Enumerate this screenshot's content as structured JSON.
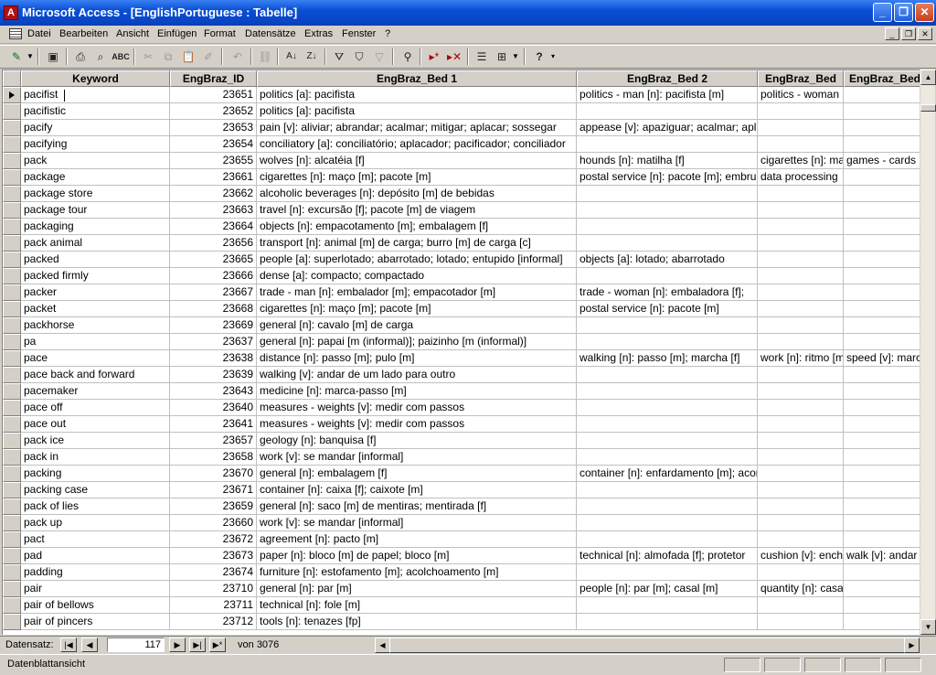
{
  "window": {
    "title": "Microsoft Access - [EnglishPortuguese : Tabelle]",
    "min_label": "_",
    "max_label": "❐",
    "close_label": "✕"
  },
  "menu": [
    "Datei",
    "Bearbeiten",
    "Ansicht",
    "Einfügen",
    "Format",
    "Datensätze",
    "Extras",
    "Fenster",
    "?"
  ],
  "toolbar": {
    "icons": [
      "design-view-icon",
      "save-icon",
      "print-icon",
      "print-preview-icon",
      "spelling-icon",
      "cut-icon",
      "copy-icon",
      "paste-icon",
      "format-painter-icon",
      "undo-icon",
      "insert-hyperlink-icon",
      "sort-ascending-icon",
      "sort-descending-icon",
      "filter-by-selection-icon",
      "filter-by-form-icon",
      "apply-filter-icon",
      "find-icon",
      "new-record-icon",
      "delete-record-icon",
      "properties-icon",
      "new-object-icon",
      "help-icon"
    ]
  },
  "table": {
    "columns": [
      "Keyword",
      "EngBraz_ID",
      "EngBraz_Bed 1",
      "EngBraz_Bed 2",
      "EngBraz_Bed",
      "EngBraz_Bed"
    ],
    "rows": [
      [
        "pacifist",
        "23651",
        "politics [a]: pacifista",
        "politics - man [n]: pacifista [m]",
        "politics - woman",
        ""
      ],
      [
        "pacifistic",
        "23652",
        "politics [a]: pacifista",
        "",
        "",
        ""
      ],
      [
        "pacify",
        "23653",
        "pain [v]: aliviar; abrandar; acalmar; mitigar; aplacar; sossegar",
        "appease [v]: apaziguar; acalmar; aplacar",
        "",
        ""
      ],
      [
        "pacifying",
        "23654",
        "conciliatory [a]: conciliatório; aplacador; pacificador; conciliador",
        "",
        "",
        ""
      ],
      [
        "pack",
        "23655",
        "wolves [n]: alcatéia [f]",
        "hounds [n]: matilha [f]",
        "cigarettes [n]: maço",
        "games - cards"
      ],
      [
        "package",
        "23661",
        "cigarettes [n]: maço [m]; pacote [m]",
        "postal service [n]: pacote [m]; embrulho",
        "data processing",
        ""
      ],
      [
        "package store",
        "23662",
        "alcoholic beverages [n]: depósito [m] de bebidas",
        "",
        "",
        ""
      ],
      [
        "package tour",
        "23663",
        "travel [n]: excursão [f]; pacote [m] de viagem",
        "",
        "",
        ""
      ],
      [
        "packaging",
        "23664",
        "objects [n]: empacotamento [m]; embalagem [f]",
        "",
        "",
        ""
      ],
      [
        "pack animal",
        "23656",
        "transport [n]: animal [m] de carga; burro [m] de carga [c]",
        "",
        "",
        ""
      ],
      [
        "packed",
        "23665",
        "people [a]: superlotado; abarrotado; lotado; entupido [informal]",
        "objects [a]: lotado; abarrotado",
        "",
        ""
      ],
      [
        "packed firmly",
        "23666",
        "dense [a]: compacto; compactado",
        "",
        "",
        ""
      ],
      [
        "packer",
        "23667",
        "trade - man [n]: embalador [m]; empacotador [m]",
        "trade - woman [n]: embaladora [f];",
        "",
        ""
      ],
      [
        "packet",
        "23668",
        "cigarettes [n]: maço [m]; pacote [m]",
        "postal service [n]: pacote [m]",
        "",
        ""
      ],
      [
        "packhorse",
        "23669",
        "general [n]: cavalo [m] de carga",
        "",
        "",
        ""
      ],
      [
        "pa",
        "23637",
        "general [n]: papai [m (informal)]; paizinho [m (informal)]",
        "",
        "",
        ""
      ],
      [
        "pace",
        "23638",
        "distance [n]: passo [m]; pulo [m]",
        "walking [n]: passo [m]; marcha [f]",
        "work [n]: ritmo [m]",
        "speed [v]: marcar"
      ],
      [
        "pace back and forward",
        "23639",
        "walking [v]: andar de um lado para outro",
        "",
        "",
        ""
      ],
      [
        "pacemaker",
        "23643",
        "medicine [n]: marca-passo [m]",
        "",
        "",
        ""
      ],
      [
        "pace off",
        "23640",
        "measures - weights [v]: medir com passos",
        "",
        "",
        ""
      ],
      [
        "pace out",
        "23641",
        "measures - weights [v]: medir com passos",
        "",
        "",
        ""
      ],
      [
        "pack ice",
        "23657",
        "geology [n]: banquisa [f]",
        "",
        "",
        ""
      ],
      [
        "pack in",
        "23658",
        "work [v]: se mandar [informal]",
        "",
        "",
        ""
      ],
      [
        "packing",
        "23670",
        "general [n]: embalagem [f]",
        "container [n]: enfardamento [m]; acondicionamento",
        "",
        ""
      ],
      [
        "packing case",
        "23671",
        "container [n]: caixa [f]; caixote [m]",
        "",
        "",
        ""
      ],
      [
        "pack of lies",
        "23659",
        "general [n]: saco [m] de mentiras; mentirada [f]",
        "",
        "",
        ""
      ],
      [
        "pack up",
        "23660",
        "work [v]: se mandar [informal]",
        "",
        "",
        ""
      ],
      [
        "pact",
        "23672",
        "agreement [n]: pacto [m]",
        "",
        "",
        ""
      ],
      [
        "pad",
        "23673",
        "paper [n]: bloco [m] de papel; bloco [m]",
        "technical [n]: almofada [f]; protetor",
        "cushion [v]: encher",
        "walk [v]: andar"
      ],
      [
        "padding",
        "23674",
        "furniture [n]: estofamento [m]; acolchoamento [m]",
        "",
        "",
        ""
      ],
      [
        "pair",
        "23710",
        "general [n]: par [m]",
        "people [n]: par [m]; casal [m]",
        "quantity [n]: casal",
        ""
      ],
      [
        "pair of bellows",
        "23711",
        "technical [n]: fole [m]",
        "",
        "",
        ""
      ],
      [
        "pair of pincers",
        "23712",
        "tools [n]: tenazes [fp]",
        "",
        "",
        ""
      ]
    ]
  },
  "navigation": {
    "label": "Datensatz:",
    "current_record": "117",
    "of_label": "von",
    "total_records": "3076"
  },
  "status": {
    "text": "Datenblattansicht"
  }
}
